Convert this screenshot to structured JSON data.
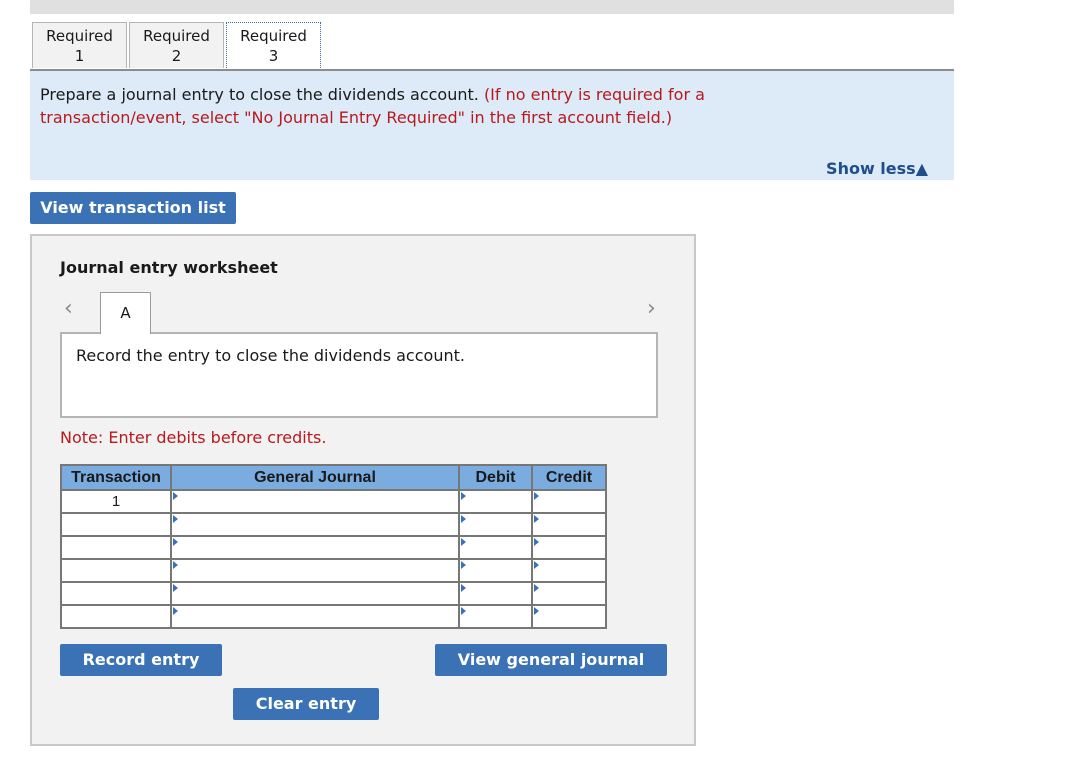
{
  "required_tabs": [
    {
      "label": "Required",
      "num": "1",
      "active": false
    },
    {
      "label": "Required",
      "num": "2",
      "active": false
    },
    {
      "label": "Required",
      "num": "3",
      "active": true
    }
  ],
  "instructions": {
    "main": "Prepare a journal entry to close the dividends account.",
    "note": "(If no entry is required for a transaction/event, select \"No Journal Entry Required\" in the first account field.)",
    "show_less": "Show less",
    "show_less_icon": "▲"
  },
  "buttons": {
    "view_transaction_list": "View transaction list",
    "record_entry": "Record entry",
    "view_general_journal": "View general journal",
    "clear_entry": "Clear entry"
  },
  "worksheet": {
    "title": "Journal entry worksheet",
    "prev_icon": "‹",
    "next_icon": "›",
    "entry_tab": "A",
    "description": "Record the entry to close the dividends account.",
    "note": "Note: Enter debits before credits.",
    "table": {
      "headers": [
        "Transaction",
        "General Journal",
        "Debit",
        "Credit"
      ],
      "rows": [
        {
          "transaction": "1",
          "account": "",
          "debit": "",
          "credit": ""
        },
        {
          "transaction": "",
          "account": "",
          "debit": "",
          "credit": ""
        },
        {
          "transaction": "",
          "account": "",
          "debit": "",
          "credit": ""
        },
        {
          "transaction": "",
          "account": "",
          "debit": "",
          "credit": ""
        },
        {
          "transaction": "",
          "account": "",
          "debit": "",
          "credit": ""
        },
        {
          "transaction": "",
          "account": "",
          "debit": "",
          "credit": ""
        }
      ]
    }
  }
}
